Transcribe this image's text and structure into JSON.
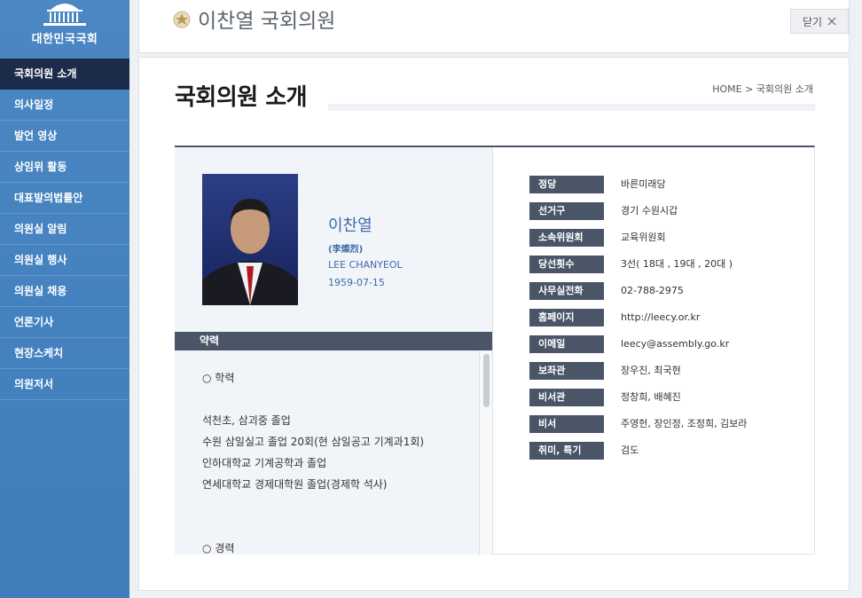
{
  "header": {
    "title": "이찬열 국회의원",
    "close_label": "닫기"
  },
  "sidebar": {
    "logo_text": "대한민국국회",
    "items": [
      {
        "label": "국회의원 소개",
        "active": true
      },
      {
        "label": "의사일정"
      },
      {
        "label": "발언 영상"
      },
      {
        "label": "상임위 활동"
      },
      {
        "label": "대표발의법률안"
      },
      {
        "label": "의원실 알림"
      },
      {
        "label": "의원실 행사"
      },
      {
        "label": "의원실 채용"
      },
      {
        "label": "언론기사"
      },
      {
        "label": "현장스케치"
      },
      {
        "label": "의원저서"
      }
    ]
  },
  "main": {
    "page_title": "국회의원 소개",
    "breadcrumb": "HOME > 국회의원 소개"
  },
  "profile": {
    "name_ko": "이찬열",
    "name_hanja": "(李燦烈)",
    "name_en": "LEE CHANYEOL",
    "birth": "1959-07-15",
    "career_title": "약력",
    "career_lines": [
      "○ 학력",
      "석천초, 삼괴중 졸업",
      "수원 삼일실고 졸업 20회(현 삼일공고 기계과1회)",
      "인하대학교 기계공학과 졸업",
      "연세대학교 경제대학원 졸업(경제학 석사)",
      "○ 경력"
    ]
  },
  "info": [
    {
      "label": "정당",
      "value": "바른미래당"
    },
    {
      "label": "선거구",
      "value": "경기 수원시갑"
    },
    {
      "label": "소속위원회",
      "value": "교육위원회"
    },
    {
      "label": "당선횟수",
      "value": "3선( 18대 , 19대 , 20대 )"
    },
    {
      "label": "사무실전화",
      "value": "02-788-2975"
    },
    {
      "label": "홈페이지",
      "value": "http://leecy.or.kr"
    },
    {
      "label": "이메일",
      "value": "leecy@assembly.go.kr"
    },
    {
      "label": "보좌관",
      "value": "장우진, 최국현"
    },
    {
      "label": "비서관",
      "value": "정창희, 배혜진"
    },
    {
      "label": "비서",
      "value": "주영헌, 장인정, 조정희, 김보라"
    },
    {
      "label": "취미, 특기",
      "value": "검도"
    }
  ],
  "colors": {
    "sidebar_bg": "#4a87c3",
    "sidebar_active": "#1d2b4b",
    "label_bg": "#4a5568",
    "name_accent": "#3f6aa8"
  }
}
